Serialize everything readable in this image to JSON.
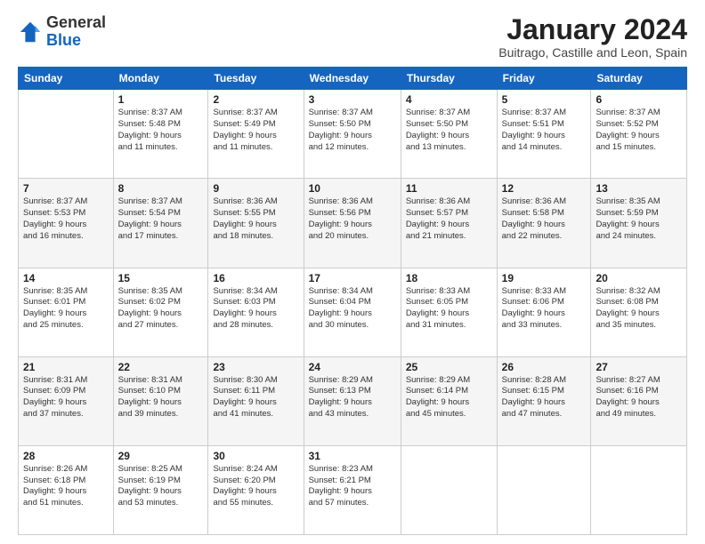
{
  "header": {
    "logo_general": "General",
    "logo_blue": "Blue",
    "title": "January 2024",
    "subtitle": "Buitrago, Castille and Leon, Spain"
  },
  "columns": [
    "Sunday",
    "Monday",
    "Tuesday",
    "Wednesday",
    "Thursday",
    "Friday",
    "Saturday"
  ],
  "weeks": [
    [
      {
        "day": "",
        "info": ""
      },
      {
        "day": "1",
        "info": "Sunrise: 8:37 AM\nSunset: 5:48 PM\nDaylight: 9 hours\nand 11 minutes."
      },
      {
        "day": "2",
        "info": "Sunrise: 8:37 AM\nSunset: 5:49 PM\nDaylight: 9 hours\nand 11 minutes."
      },
      {
        "day": "3",
        "info": "Sunrise: 8:37 AM\nSunset: 5:50 PM\nDaylight: 9 hours\nand 12 minutes."
      },
      {
        "day": "4",
        "info": "Sunrise: 8:37 AM\nSunset: 5:50 PM\nDaylight: 9 hours\nand 13 minutes."
      },
      {
        "day": "5",
        "info": "Sunrise: 8:37 AM\nSunset: 5:51 PM\nDaylight: 9 hours\nand 14 minutes."
      },
      {
        "day": "6",
        "info": "Sunrise: 8:37 AM\nSunset: 5:52 PM\nDaylight: 9 hours\nand 15 minutes."
      }
    ],
    [
      {
        "day": "7",
        "info": "Sunrise: 8:37 AM\nSunset: 5:53 PM\nDaylight: 9 hours\nand 16 minutes."
      },
      {
        "day": "8",
        "info": "Sunrise: 8:37 AM\nSunset: 5:54 PM\nDaylight: 9 hours\nand 17 minutes."
      },
      {
        "day": "9",
        "info": "Sunrise: 8:36 AM\nSunset: 5:55 PM\nDaylight: 9 hours\nand 18 minutes."
      },
      {
        "day": "10",
        "info": "Sunrise: 8:36 AM\nSunset: 5:56 PM\nDaylight: 9 hours\nand 20 minutes."
      },
      {
        "day": "11",
        "info": "Sunrise: 8:36 AM\nSunset: 5:57 PM\nDaylight: 9 hours\nand 21 minutes."
      },
      {
        "day": "12",
        "info": "Sunrise: 8:36 AM\nSunset: 5:58 PM\nDaylight: 9 hours\nand 22 minutes."
      },
      {
        "day": "13",
        "info": "Sunrise: 8:35 AM\nSunset: 5:59 PM\nDaylight: 9 hours\nand 24 minutes."
      }
    ],
    [
      {
        "day": "14",
        "info": "Sunrise: 8:35 AM\nSunset: 6:01 PM\nDaylight: 9 hours\nand 25 minutes."
      },
      {
        "day": "15",
        "info": "Sunrise: 8:35 AM\nSunset: 6:02 PM\nDaylight: 9 hours\nand 27 minutes."
      },
      {
        "day": "16",
        "info": "Sunrise: 8:34 AM\nSunset: 6:03 PM\nDaylight: 9 hours\nand 28 minutes."
      },
      {
        "day": "17",
        "info": "Sunrise: 8:34 AM\nSunset: 6:04 PM\nDaylight: 9 hours\nand 30 minutes."
      },
      {
        "day": "18",
        "info": "Sunrise: 8:33 AM\nSunset: 6:05 PM\nDaylight: 9 hours\nand 31 minutes."
      },
      {
        "day": "19",
        "info": "Sunrise: 8:33 AM\nSunset: 6:06 PM\nDaylight: 9 hours\nand 33 minutes."
      },
      {
        "day": "20",
        "info": "Sunrise: 8:32 AM\nSunset: 6:08 PM\nDaylight: 9 hours\nand 35 minutes."
      }
    ],
    [
      {
        "day": "21",
        "info": "Sunrise: 8:31 AM\nSunset: 6:09 PM\nDaylight: 9 hours\nand 37 minutes."
      },
      {
        "day": "22",
        "info": "Sunrise: 8:31 AM\nSunset: 6:10 PM\nDaylight: 9 hours\nand 39 minutes."
      },
      {
        "day": "23",
        "info": "Sunrise: 8:30 AM\nSunset: 6:11 PM\nDaylight: 9 hours\nand 41 minutes."
      },
      {
        "day": "24",
        "info": "Sunrise: 8:29 AM\nSunset: 6:13 PM\nDaylight: 9 hours\nand 43 minutes."
      },
      {
        "day": "25",
        "info": "Sunrise: 8:29 AM\nSunset: 6:14 PM\nDaylight: 9 hours\nand 45 minutes."
      },
      {
        "day": "26",
        "info": "Sunrise: 8:28 AM\nSunset: 6:15 PM\nDaylight: 9 hours\nand 47 minutes."
      },
      {
        "day": "27",
        "info": "Sunrise: 8:27 AM\nSunset: 6:16 PM\nDaylight: 9 hours\nand 49 minutes."
      }
    ],
    [
      {
        "day": "28",
        "info": "Sunrise: 8:26 AM\nSunset: 6:18 PM\nDaylight: 9 hours\nand 51 minutes."
      },
      {
        "day": "29",
        "info": "Sunrise: 8:25 AM\nSunset: 6:19 PM\nDaylight: 9 hours\nand 53 minutes."
      },
      {
        "day": "30",
        "info": "Sunrise: 8:24 AM\nSunset: 6:20 PM\nDaylight: 9 hours\nand 55 minutes."
      },
      {
        "day": "31",
        "info": "Sunrise: 8:23 AM\nSunset: 6:21 PM\nDaylight: 9 hours\nand 57 minutes."
      },
      {
        "day": "",
        "info": ""
      },
      {
        "day": "",
        "info": ""
      },
      {
        "day": "",
        "info": ""
      }
    ]
  ]
}
